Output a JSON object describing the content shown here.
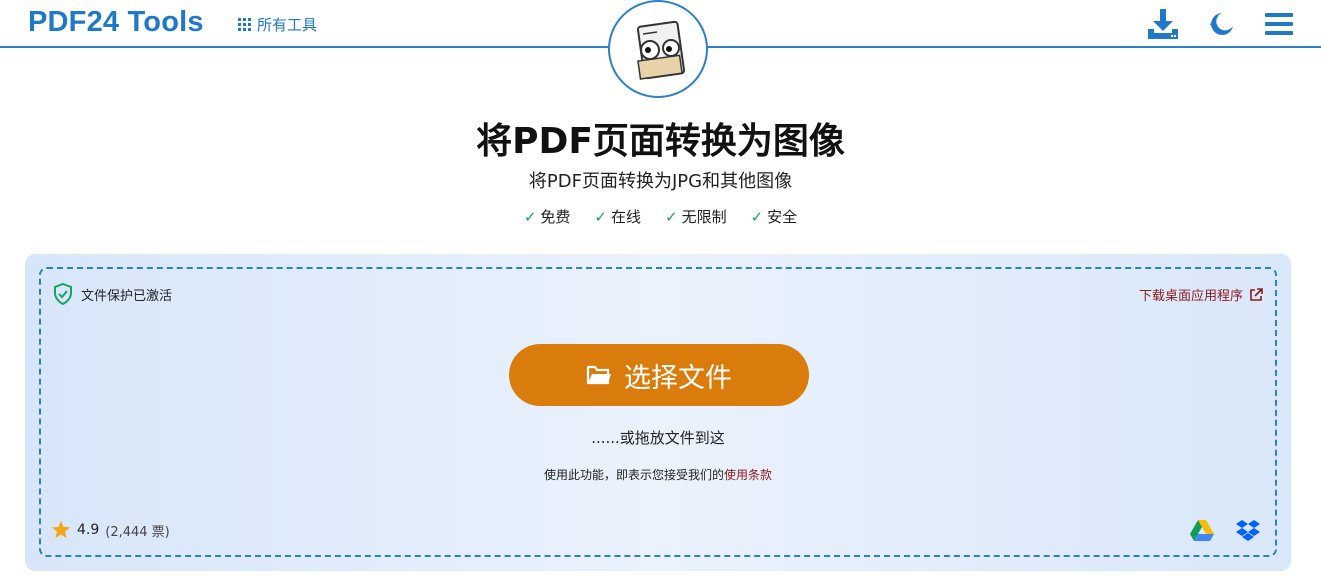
{
  "header": {
    "logo": "PDF24 Tools",
    "all_tools_label": "所有工具",
    "icons": [
      "download-icon",
      "night-mode-icon",
      "menu-icon"
    ]
  },
  "hero": {
    "title": "将PDF页面转换为图像",
    "subtitle": "将PDF页面转换为JPG和其他图像",
    "features": [
      "免费",
      "在线",
      "无限制",
      "安全"
    ]
  },
  "upload": {
    "protection_label": "文件保护已激活",
    "desktop_link": "下载桌面应用程序",
    "choose_button": "选择文件",
    "drop_hint": "......或拖放文件到这",
    "terms_prefix": "使用此功能，即表示您接受我们的",
    "terms_link": "使用条款",
    "rating_value": "4.9",
    "rating_votes": "(2,444 票)",
    "cloud_sources": [
      "google-drive-icon",
      "dropbox-icon"
    ]
  },
  "colors": {
    "brand_blue": "#1f78c8",
    "button_orange": "#d97c0c",
    "link_red": "#8b1a1a",
    "check_green": "#1aa260",
    "star_gold": "#f2a515"
  }
}
